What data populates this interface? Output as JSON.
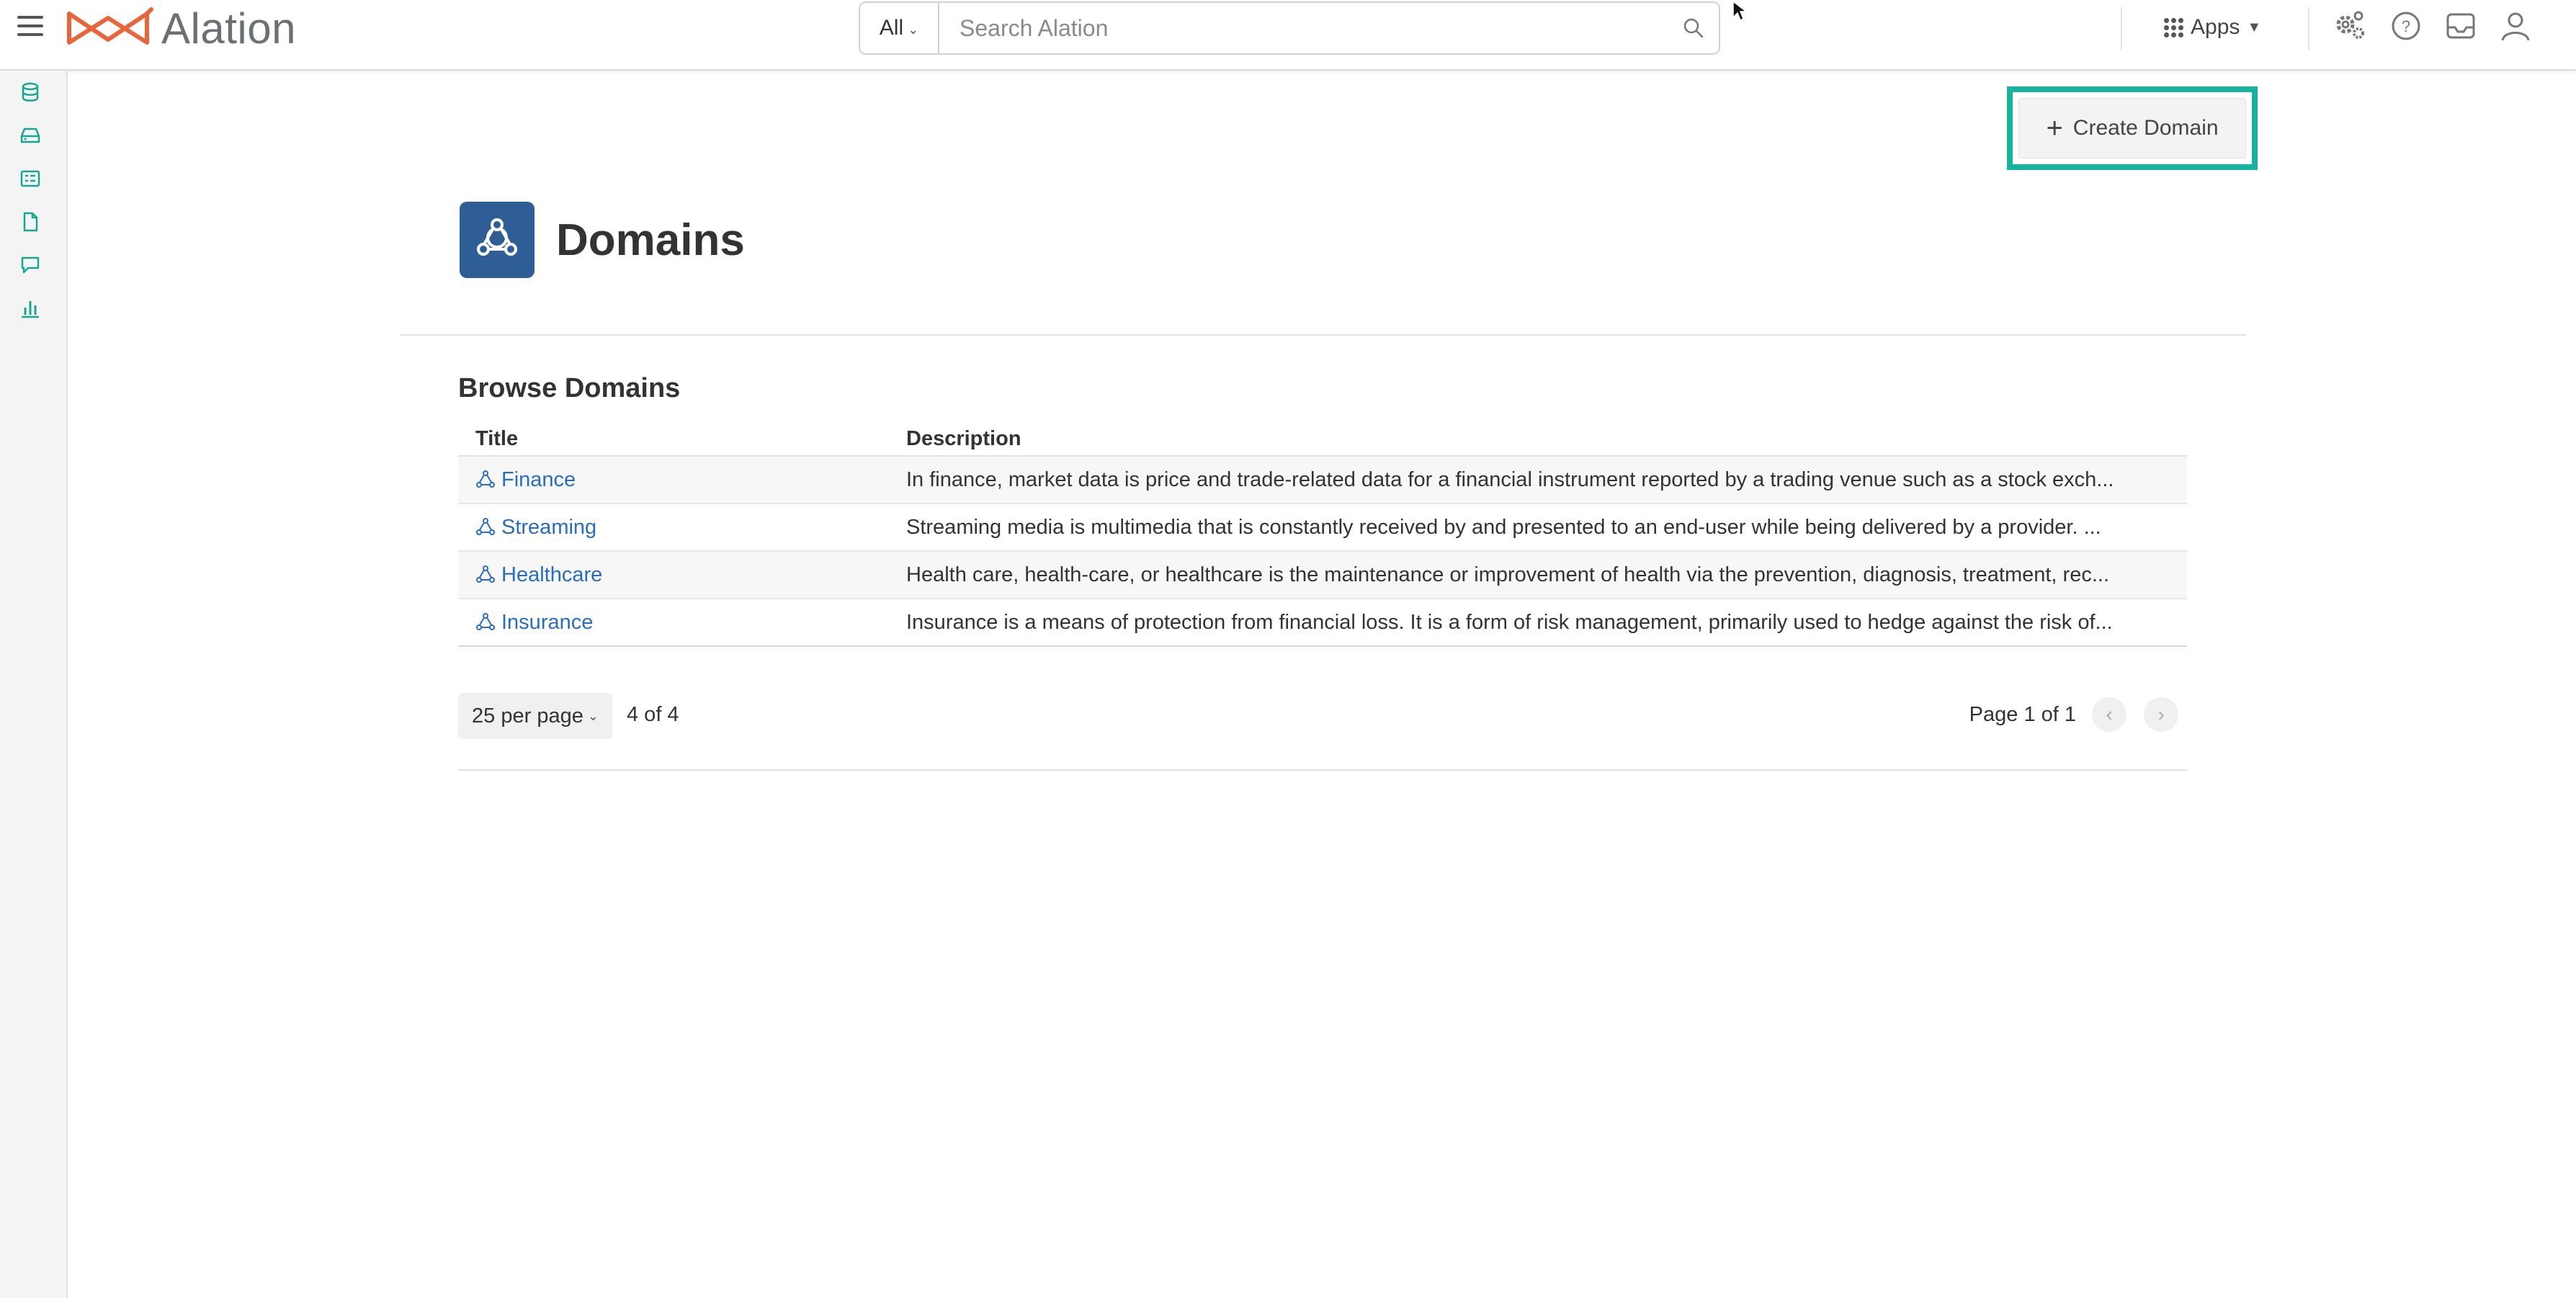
{
  "app": {
    "logo_text": "Alation",
    "brand_color": "#e8663c",
    "accent_color": "#17b39e"
  },
  "search": {
    "scope_label": "All",
    "placeholder": "Search Alation",
    "value": ""
  },
  "toolbar": {
    "apps_label": "Apps",
    "icons": [
      "settings-icon",
      "help-icon",
      "inbox-icon",
      "user-icon"
    ]
  },
  "sidebar": {
    "icons": [
      "database-icon",
      "storage-icon",
      "catalog-list-icon",
      "document-icon",
      "conversation-icon",
      "bar-chart-icon"
    ]
  },
  "main": {
    "create_button_label": "Create Domain",
    "page_title": "Domains",
    "section_title": "Browse Domains",
    "columns": [
      "Title",
      "Description"
    ],
    "rows": [
      {
        "title": "Finance",
        "description": "In finance, market data is price and trade-related data for a financial instrument reported by a trading venue such as a stock exch..."
      },
      {
        "title": "Streaming",
        "description": "Streaming media is multimedia that is constantly received by and presented to an end-user while being delivered by a provider. ..."
      },
      {
        "title": "Healthcare",
        "description": "Health care, health-care, or healthcare is the maintenance or improvement of health via the prevention, diagnosis, treatment, rec..."
      },
      {
        "title": "Insurance",
        "description": "Insurance is a means of protection from financial loss. It is a form of risk management, primarily used to hedge against the risk of..."
      }
    ],
    "pagination": {
      "per_page_label": "25 per page",
      "count_label": "4 of 4",
      "page_label": "Page 1 of 1"
    }
  }
}
